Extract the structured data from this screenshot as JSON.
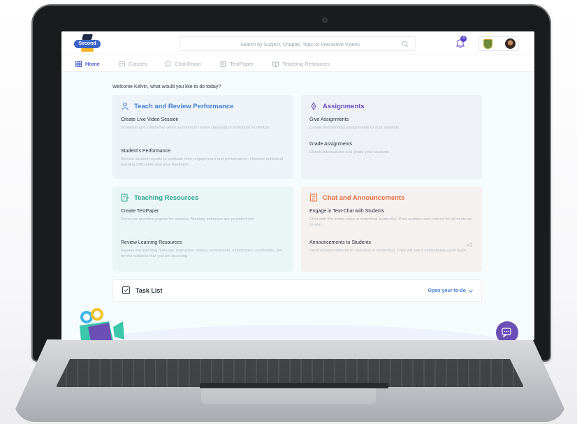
{
  "header": {
    "logo_text": "Second",
    "search_placeholder": "Search by Subject, Chapter, Topic or Interactive Videos",
    "notification_count": "4"
  },
  "nav": [
    {
      "label": "Home"
    },
    {
      "label": "Classes"
    },
    {
      "label": "Chat Room"
    },
    {
      "label": "TestPaper"
    },
    {
      "label": "Teaching Resources"
    }
  ],
  "welcome": "Welcome Kelvin, what would you like to do today?",
  "cards": {
    "teach": {
      "title": "Teach and Review Performance",
      "color": "#3f7fd8",
      "items": [
        {
          "title": "Create Live Video Session",
          "desc": "Schedule and create live video sessions for entire class(es) or individual student(s)"
        },
        {
          "title": "Student's Performance",
          "desc": "Review student reports to evaluate their engagement and performance. Uncover individual learning difficulties and give feedback."
        }
      ]
    },
    "assign": {
      "title": "Assignments",
      "color": "#6a4fbf",
      "items": [
        {
          "title": "Give Assignments",
          "desc": "Create and handout assignments to your students"
        },
        {
          "title": "Grade Assignments",
          "desc": "Check submissions and grade your students"
        }
      ]
    },
    "resources": {
      "title": "Teaching Resources",
      "color": "#2fa58f",
      "items": [
        {
          "title": "Create TestPaper",
          "desc": "Generate question papers for practice. Marking schemes are provided too!"
        },
        {
          "title": "Review Learning Resources",
          "desc": "Review the teaching manuals, interactive videos, worksheets, eTextbooks, workbooks, etc, for the subjects that you are teaching"
        }
      ]
    },
    "chat": {
      "title": "Chat and Announcements",
      "color": "#e86f45",
      "items": [
        {
          "title": "Engage in Text-Chat with Students",
          "desc": "Chat with the entire class or individual student(s). Post updates and notices for all students to see"
        },
        {
          "title": "Announcements to Students",
          "desc": "Send announcements to class(es) or student(s). They will see it immediately upon login"
        }
      ]
    }
  },
  "tasklist": {
    "label": "Task List",
    "action": "Open your to-do"
  }
}
